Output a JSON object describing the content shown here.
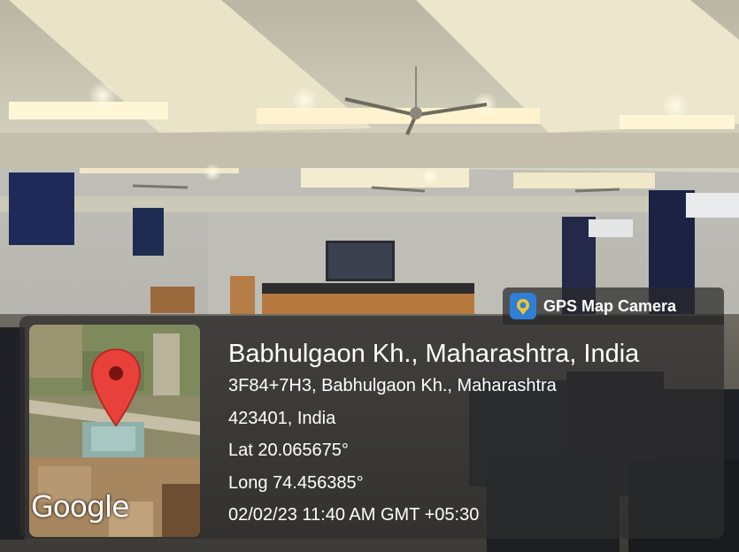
{
  "badge": {
    "label": "GPS Map Camera",
    "icon": "map-pin-icon"
  },
  "map": {
    "brand": "Google",
    "pin_color": "#e8403a"
  },
  "location": {
    "title": "Babhulgaon Kh., Maharashtra, India",
    "address_line1": "3F84+7H3, Babhulgaon Kh., Maharashtra",
    "address_line2": "423401, India",
    "latitude": "Lat 20.065675°",
    "longitude": "Long 74.456385°",
    "timestamp": "02/02/23 11:40 AM GMT +05:30"
  }
}
